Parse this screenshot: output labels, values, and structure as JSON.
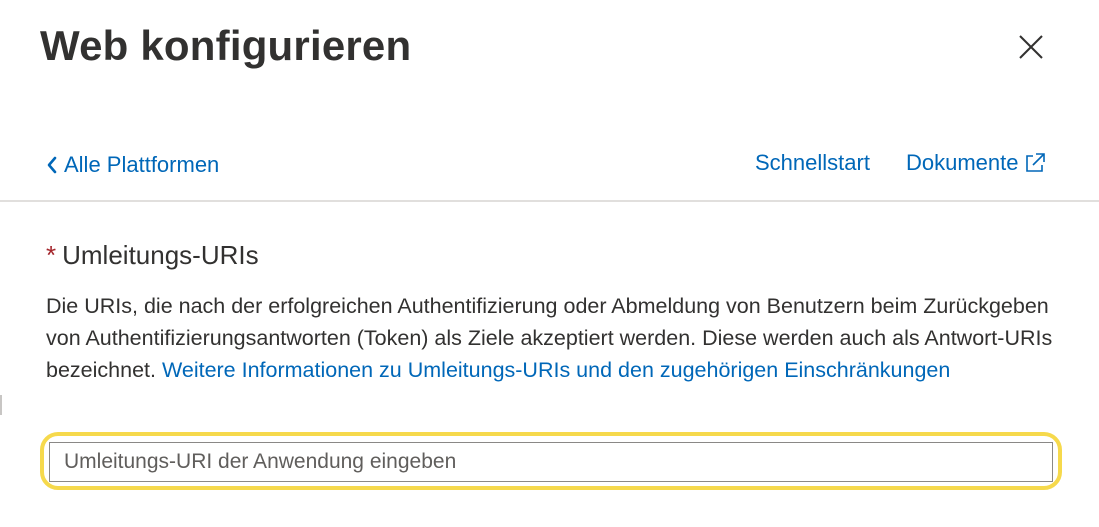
{
  "header": {
    "title": "Web konfigurieren",
    "close_icon": "close-icon"
  },
  "nav": {
    "back_label": "Alle Plattformen",
    "back_icon": "chevron-left-icon",
    "quickstart_label": "Schnellstart",
    "docs_label": "Dokumente",
    "docs_icon": "external-link-icon"
  },
  "redirect_uris": {
    "required_marker": "*",
    "label": "Umleitungs-URIs",
    "description": "Die URIs, die nach der erfolgreichen Authentifizierung oder Abmeldung von Benutzern beim Zurückgeben von Authentifizierungsantworten (Token) als Ziele akzeptiert werden. Diese werden auch als Antwort-URIs bezeichnet.",
    "learn_more_link": "Weitere Informationen zu Umleitungs-URIs und den zugehörigen Einschränkungen",
    "input_placeholder": "Umleitungs-URI der Anwendung eingeben",
    "input_value": ""
  },
  "colors": {
    "link": "#0067b8",
    "text": "#323130",
    "required": "#a4262c",
    "highlight": "#f6d94c",
    "divider": "#e1dfdd"
  }
}
